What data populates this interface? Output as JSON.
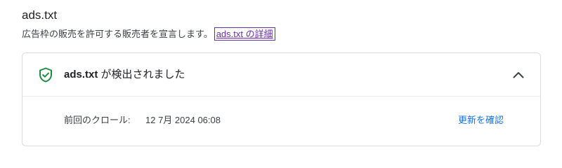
{
  "section": {
    "title": "ads.txt",
    "description": "広告枠の販売を許可する販売者を宣言します。",
    "details_link": "ads.txt の詳細"
  },
  "status_card": {
    "status_icon": "shield-check-icon",
    "status_color": "#1e8e3e",
    "title_bold": "ads.txt",
    "title_rest": " が検出されました",
    "expand_icon": "chevron-up-icon",
    "last_crawl_label": "前回のクロール:",
    "last_crawl_value": "12 7月 2024 06:08",
    "recheck_label": "更新を確認"
  },
  "colors": {
    "link_visited": "#6a2cae",
    "action_blue": "#1a73e8",
    "border": "#dadce0"
  }
}
